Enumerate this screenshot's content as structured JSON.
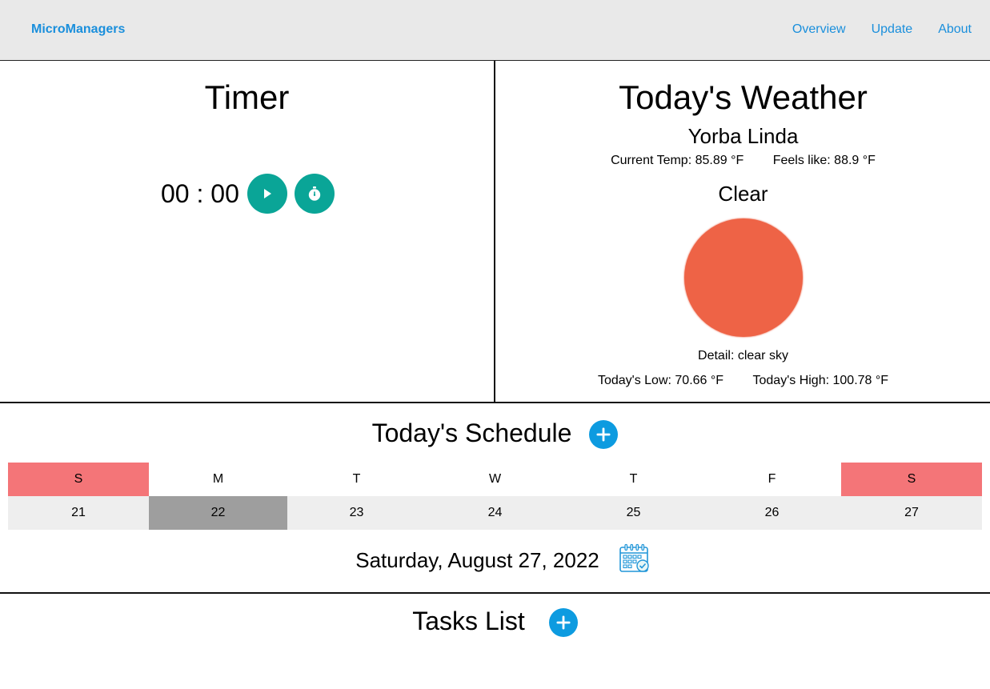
{
  "navbar": {
    "brand": "MicroManagers",
    "links": [
      "Overview",
      "Update",
      "About"
    ]
  },
  "timer": {
    "title": "Timer",
    "display": "00 : 00",
    "play_icon": "play-icon",
    "stopwatch_icon": "stopwatch-icon"
  },
  "weather": {
    "title": "Today's Weather",
    "city": "Yorba Linda",
    "current_temp": "Current Temp: 85.89 °F",
    "feels_like": "Feels like: 88.9 °F",
    "condition": "Clear",
    "detail": "Detail: clear sky",
    "low": "Today's Low: 70.66 °F",
    "high": "Today's High: 100.78 °F",
    "sun_color": "#ee6346"
  },
  "schedule": {
    "title": "Today's Schedule",
    "weekdays": [
      "S",
      "M",
      "T",
      "W",
      "T",
      "F",
      "S"
    ],
    "days": [
      "21",
      "22",
      "23",
      "24",
      "25",
      "26",
      "27"
    ],
    "selected_day": "22",
    "date": "Saturday, August 27, 2022",
    "calendar_icon": "calendar-check-icon",
    "weekend_color": "#f47578"
  },
  "tasks": {
    "title": "Tasks List"
  },
  "colors": {
    "accent": "#1a8fdc",
    "teal": "#0aa597",
    "add_button": "#0d9be0"
  }
}
